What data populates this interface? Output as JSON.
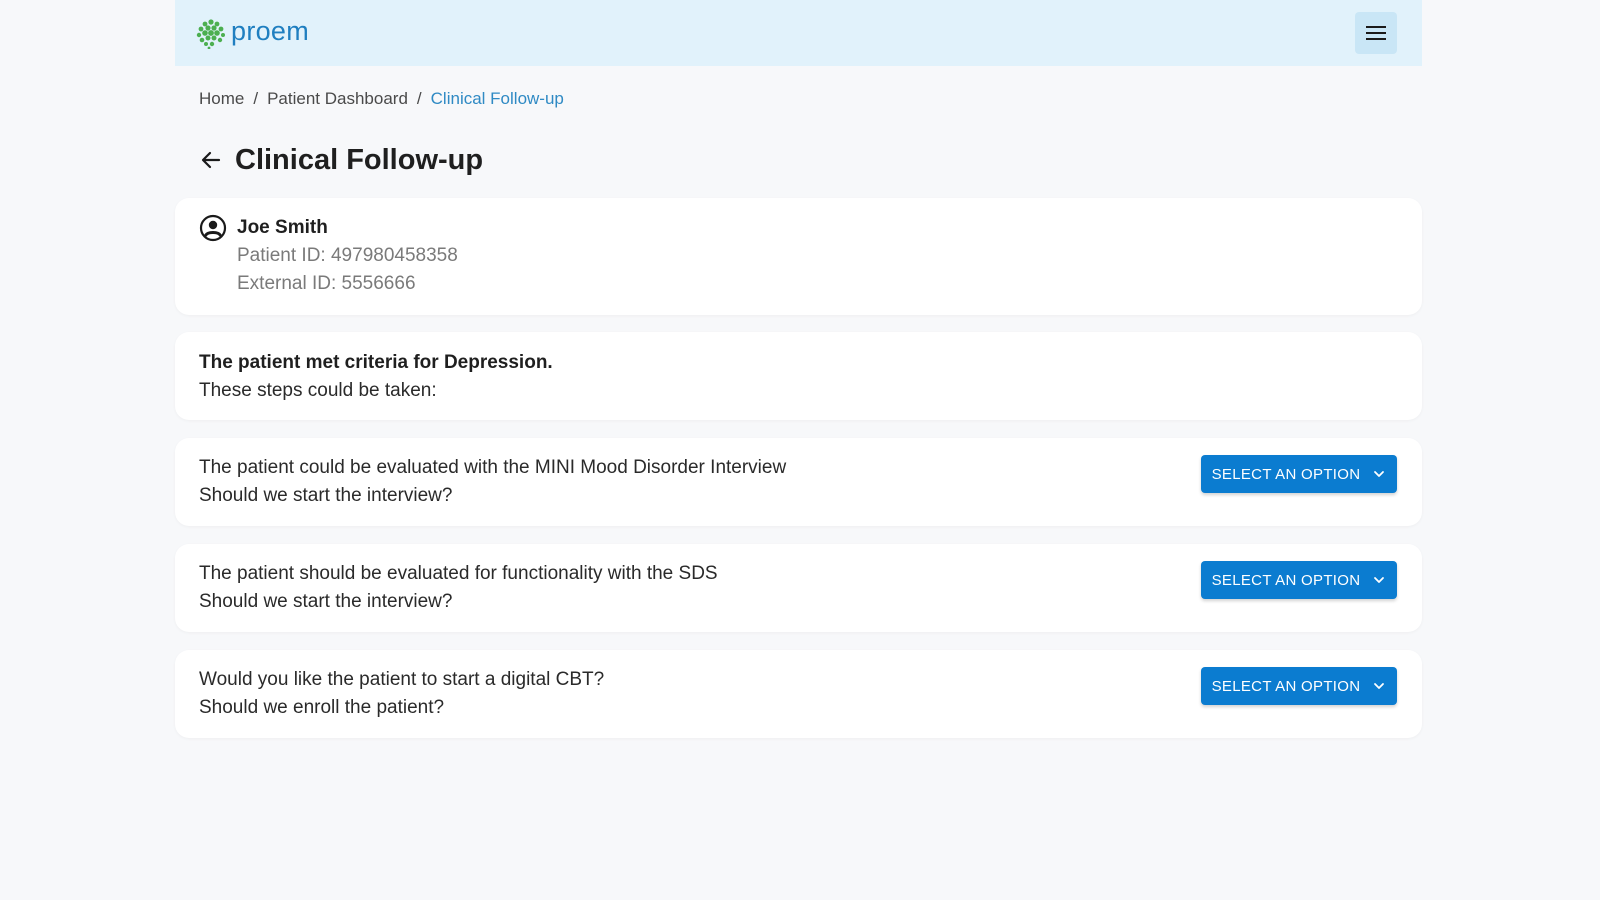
{
  "header": {
    "brand": "proem",
    "brand_color": "#1f7fc0",
    "logo_icon": "proem-dots-logo-icon",
    "menu_icon": "hamburger-menu-icon"
  },
  "breadcrumb": {
    "items": [
      "Home",
      "Patient Dashboard",
      "Clinical Follow-up"
    ],
    "separator": "/"
  },
  "page": {
    "title": "Clinical Follow-up",
    "back_icon": "arrow-left-icon"
  },
  "patient": {
    "name": "Joe Smith",
    "patient_id": "Patient ID: 497980458358",
    "external_id": "External ID: 5556666",
    "avatar_icon": "user-circle-icon"
  },
  "criteria": {
    "title": "The patient met criteria for Depression.",
    "subtitle": "These steps could be taken:"
  },
  "steps": [
    {
      "line1": "The patient could be evaluated with the MINI Mood Disorder Interview",
      "line2": "Should we start the interview?",
      "button": "SELECT AN OPTION"
    },
    {
      "line1": "The patient should be evaluated for functionality with the SDS",
      "line2": "Should we start the interview?",
      "button": "SELECT AN OPTION"
    },
    {
      "line1": "Would you like the patient to start a digital CBT?",
      "line2": "Should we enroll the patient?",
      "button": "SELECT AN OPTION"
    }
  ],
  "colors": {
    "accent": "#0b7cd0",
    "header_bg": "#e1f2fb",
    "breadcrumb_current": "#2f8ac4",
    "logo_green": "#4caf50"
  }
}
